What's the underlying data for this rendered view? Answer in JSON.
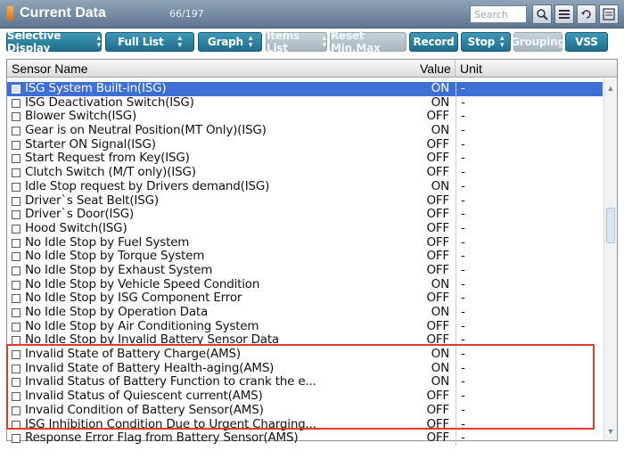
{
  "window": {
    "title": "Current Data",
    "count": "66/197",
    "search_placeholder": "Search"
  },
  "toolbar": {
    "buttons": [
      {
        "label": "Selective Display",
        "dropdown": true,
        "enabled": true
      },
      {
        "label": "Full List",
        "dropdown": true,
        "enabled": true
      },
      {
        "label": "Graph",
        "dropdown": true,
        "enabled": true
      },
      {
        "label": "Items List",
        "dropdown": true,
        "enabled": false
      },
      {
        "label": "Reset Min.Max",
        "dropdown": false,
        "enabled": false
      },
      {
        "label": "Record",
        "dropdown": false,
        "enabled": true
      },
      {
        "label": "Stop",
        "dropdown": true,
        "enabled": true
      },
      {
        "label": "Grouping",
        "dropdown": false,
        "enabled": false
      },
      {
        "label": "VSS",
        "dropdown": false,
        "enabled": true
      }
    ],
    "icons": [
      "search-zoom-icon",
      "list-icon",
      "retry-icon",
      "menu-icon"
    ],
    "retry_label": "Retry"
  },
  "table": {
    "columns": {
      "name": "Sensor Name",
      "value": "Value",
      "unit": "Unit"
    },
    "rows": [
      {
        "name": "ISG System Built-in(ISG)",
        "value": "ON",
        "unit": "-",
        "selected": true
      },
      {
        "name": "ISG Deactivation Switch(ISG)",
        "value": "ON",
        "unit": "-"
      },
      {
        "name": "Blower Switch(ISG)",
        "value": "OFF",
        "unit": "-"
      },
      {
        "name": "Gear is on Neutral Position(MT Only)(ISG)",
        "value": "ON",
        "unit": "-"
      },
      {
        "name": "Starter ON Signal(ISG)",
        "value": "OFF",
        "unit": "-"
      },
      {
        "name": "Start Request from Key(ISG)",
        "value": "OFF",
        "unit": "-"
      },
      {
        "name": "Clutch Switch (M/T only)(ISG)",
        "value": "OFF",
        "unit": "-"
      },
      {
        "name": "Idle Stop request by Drivers demand(ISG)",
        "value": "ON",
        "unit": "-"
      },
      {
        "name": "Driver`s Seat Belt(ISG)",
        "value": "OFF",
        "unit": "-"
      },
      {
        "name": "Driver`s Door(ISG)",
        "value": "OFF",
        "unit": "-"
      },
      {
        "name": "Hood Switch(ISG)",
        "value": "OFF",
        "unit": "-"
      },
      {
        "name": "No Idle Stop by Fuel System",
        "value": "OFF",
        "unit": "-"
      },
      {
        "name": "No Idle Stop by Torque System",
        "value": "OFF",
        "unit": "-"
      },
      {
        "name": "No Idle Stop by Exhaust System",
        "value": "OFF",
        "unit": "-"
      },
      {
        "name": "No Idle Stop by Vehicle Speed Condition",
        "value": "ON",
        "unit": "-"
      },
      {
        "name": "No Idle Stop by ISG Component Error",
        "value": "OFF",
        "unit": "-"
      },
      {
        "name": "No Idle Stop by Operation Data",
        "value": "ON",
        "unit": "-"
      },
      {
        "name": "No Idle Stop by Air Conditioning System",
        "value": "OFF",
        "unit": "-"
      },
      {
        "name": "No Idle Stop by Invalid Battery Sensor Data",
        "value": "OFF",
        "unit": "-"
      },
      {
        "name": "Invalid State of Battery Charge(AMS)",
        "value": "ON",
        "unit": "-"
      },
      {
        "name": "Invalid State of Battery Health-aging(AMS)",
        "value": "ON",
        "unit": "-"
      },
      {
        "name": "Invalid Status of Battery Function to crank the e...",
        "value": "ON",
        "unit": "-"
      },
      {
        "name": "Invalid Status of Quiescent current(AMS)",
        "value": "OFF",
        "unit": "-"
      },
      {
        "name": "Invalid Condition of Battery Sensor(AMS)",
        "value": "OFF",
        "unit": "-"
      },
      {
        "name": "ISG Inhibition Condition Due to Urgent Charging...",
        "value": "OFF",
        "unit": "-"
      },
      {
        "name": "Response Error Flag from Battery Sensor(AMS)",
        "value": "OFF",
        "unit": "-"
      }
    ]
  },
  "colors": {
    "accent": "#1d6f8d",
    "selection": "#3d6fd6",
    "highlight": "#e4392a"
  }
}
